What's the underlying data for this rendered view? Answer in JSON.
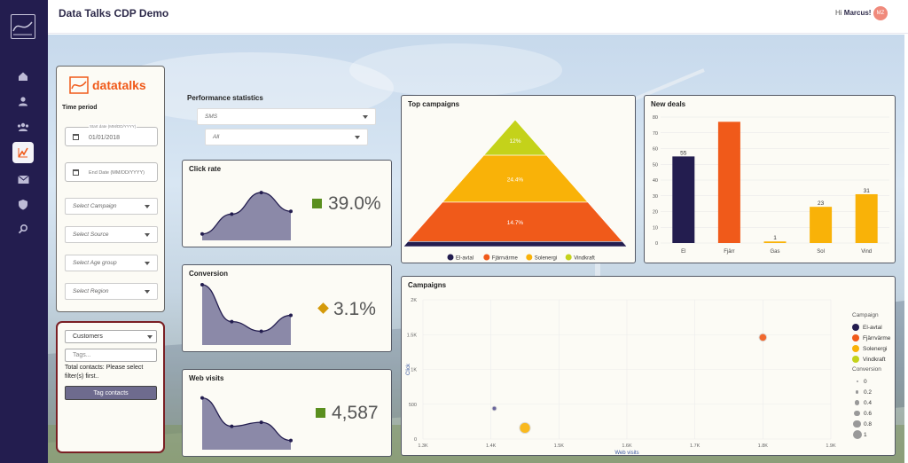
{
  "app": {
    "title": "Data Talks CDP Demo",
    "greeting": "Hi",
    "user": "Marcus!",
    "avatar_initials": "MZ"
  },
  "sidebar": {
    "items": [
      {
        "name": "home",
        "icon": "home-icon"
      },
      {
        "name": "profile",
        "icon": "person-icon"
      },
      {
        "name": "audience",
        "icon": "group-icon"
      },
      {
        "name": "analytics",
        "icon": "chart-icon",
        "active": true
      },
      {
        "name": "campaigns",
        "icon": "mail-icon"
      },
      {
        "name": "privacy",
        "icon": "shield-icon"
      },
      {
        "name": "search",
        "icon": "magnifier-icon"
      }
    ]
  },
  "filters": {
    "brand": "datatalks",
    "time_period_label": "Time period",
    "start_date_label": "Start date (MM/DD/YYYY)",
    "start_date_value": "01/01/2018",
    "end_date_placeholder": "End Date (MM/DD/YYYY)",
    "campaign_placeholder": "Select Campaign",
    "source_placeholder": "Select Source",
    "age_placeholder": "Select Age group",
    "region_placeholder": "Select Region"
  },
  "tag_panel": {
    "dropdown_value": "Customers",
    "tags_placeholder": "Tags...",
    "status_text": "Total contacts: Please select filter(s) first..",
    "button_label": "Tag contacts"
  },
  "performance": {
    "title": "Performance statistics",
    "channel_select": "SMS",
    "period_select": "All"
  },
  "kpis": {
    "click_rate": {
      "title": "Click rate",
      "value": "39.0%",
      "marker_color": "#5a8f1e",
      "marker": "square"
    },
    "conversion": {
      "title": "Conversion",
      "value": "3.1%",
      "marker_color": "#d49a0a",
      "marker": "diamond"
    },
    "web_visits": {
      "title": "Web visits",
      "value": "4,587",
      "marker_color": "#5a8f1e",
      "marker": "square"
    }
  },
  "top_campaigns": {
    "title": "Top campaigns",
    "levels": [
      {
        "label": "12%",
        "color": "#c4d21a"
      },
      {
        "label": "24.4%",
        "color": "#f9b208"
      },
      {
        "label": "14.7%",
        "color": "#f05a1a"
      },
      {
        "label": "",
        "color": "#231d4f"
      }
    ],
    "legend": [
      {
        "name": "El-avtal",
        "color": "#231d4f"
      },
      {
        "name": "Fjärrvärme",
        "color": "#f05a1a"
      },
      {
        "name": "Solenergi",
        "color": "#f9b208"
      },
      {
        "name": "Vindkraft",
        "color": "#c4d21a"
      }
    ]
  },
  "new_deals": {
    "title": "New deals"
  },
  "campaigns": {
    "title": "Campaigns",
    "legend_title": "Campaign",
    "legend": [
      {
        "name": "El-avtal",
        "color": "#231d4f"
      },
      {
        "name": "Fjärrvärme",
        "color": "#f05a1a"
      },
      {
        "name": "Solenergi",
        "color": "#f9b208"
      },
      {
        "name": "Vindkraft",
        "color": "#c4d21a"
      }
    ],
    "size_title": "Conversion",
    "sizes": [
      "0",
      "0.2",
      "0.4",
      "0.6",
      "0.8",
      "1"
    ]
  },
  "chart_data": [
    {
      "type": "bar",
      "title": "New deals",
      "categories": [
        "El",
        "Fjärr",
        "Gas",
        "Sol",
        "Vind"
      ],
      "values": [
        55,
        77,
        1,
        23,
        31
      ],
      "colors": [
        "#231d4f",
        "#f05a1a",
        "#f9b208",
        "#f9b208",
        "#f9b208"
      ],
      "ylim": [
        0,
        80
      ],
      "yticks": [
        0,
        10,
        20,
        30,
        40,
        50,
        60,
        70,
        80
      ],
      "labels": [
        "55",
        "",
        "1",
        "23",
        "31"
      ],
      "grid": true
    },
    {
      "type": "area",
      "title": "Click rate",
      "values": [
        0.05,
        0.4,
        0.78,
        0.45
      ],
      "color": "#8b89a8"
    },
    {
      "type": "area",
      "title": "Conversion",
      "values": [
        1.0,
        0.35,
        0.18,
        0.46
      ],
      "color": "#8b89a8"
    },
    {
      "type": "area",
      "title": "Web visits",
      "values": [
        0.85,
        0.35,
        0.42,
        0.1
      ],
      "color": "#8b89a8"
    },
    {
      "type": "scatter",
      "title": "Campaigns",
      "xlabel": "Web visits",
      "ylabel": "Click",
      "xlim": [
        1300,
        1900
      ],
      "ylim": [
        0,
        2000
      ],
      "xticks": [
        {
          "v": 1300,
          "t": "1.3K"
        },
        {
          "v": 1400,
          "t": "1.4K"
        },
        {
          "v": 1500,
          "t": "1.5K"
        },
        {
          "v": 1600,
          "t": "1.6K"
        },
        {
          "v": 1700,
          "t": "1.7K"
        },
        {
          "v": 1800,
          "t": "1.8K"
        },
        {
          "v": 1900,
          "t": "1.9K"
        }
      ],
      "yticks": [
        {
          "v": 0,
          "t": "0"
        },
        {
          "v": 500,
          "t": "500"
        },
        {
          "v": 1000,
          "t": "1K"
        },
        {
          "v": 1500,
          "t": "1.5K"
        },
        {
          "v": 2000,
          "t": "2K"
        }
      ],
      "points": [
        {
          "series": "El-avtal",
          "x": 1405,
          "y": 440,
          "conversion": 0.0,
          "color": "#5a5492"
        },
        {
          "series": "Solenergi",
          "x": 1450,
          "y": 160,
          "conversion": 0.6,
          "color": "#f9b208"
        },
        {
          "series": "Fjärrvärme",
          "x": 1800,
          "y": 1460,
          "conversion": 0.3,
          "color": "#f05a1a"
        }
      ]
    }
  ]
}
